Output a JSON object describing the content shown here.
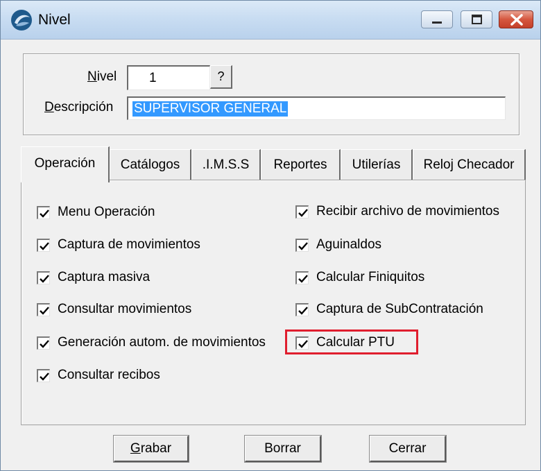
{
  "window": {
    "title": "Nivel",
    "accent": "#1f5a8c"
  },
  "form": {
    "nivel_label_first": "N",
    "nivel_label_rest": "ivel",
    "nivel_value": "1",
    "help_button": "?",
    "descripcion_label_first": "D",
    "descripcion_label_rest": "escripción",
    "descripcion_value": "SUPERVISOR GENERAL"
  },
  "tabs": [
    {
      "label": "Operación",
      "active": true
    },
    {
      "label": "Catálogos",
      "active": false
    },
    {
      "label": ".I.M.S.S",
      "active": false
    },
    {
      "label": "Reportes",
      "active": false
    },
    {
      "label": "Utilerías",
      "active": false
    },
    {
      "label": "Reloj Checador",
      "active": false
    }
  ],
  "options_left": [
    {
      "label": "Menu Operación",
      "checked": true
    },
    {
      "label": "Captura de movimientos",
      "checked": true
    },
    {
      "label": "Captura masiva",
      "checked": true
    },
    {
      "label": "Consultar movimientos",
      "checked": true
    },
    {
      "label": "Generación autom. de movimientos",
      "checked": true
    },
    {
      "label": "Consultar recibos",
      "checked": true
    }
  ],
  "options_right": [
    {
      "label": "Recibir archivo de movimientos",
      "checked": true
    },
    {
      "label": "Aguinaldos",
      "checked": true
    },
    {
      "label": "Calcular Finiquitos",
      "checked": true
    },
    {
      "label": "Captura de SubContratación",
      "checked": true
    },
    {
      "label": "Calcular PTU",
      "checked": true,
      "highlighted": true
    }
  ],
  "highlight_color": "#e01e2e",
  "buttons": {
    "grabar_first": "G",
    "grabar_rest": "rabar",
    "borrar": "Borrar",
    "cerrar": "Cerrar"
  }
}
